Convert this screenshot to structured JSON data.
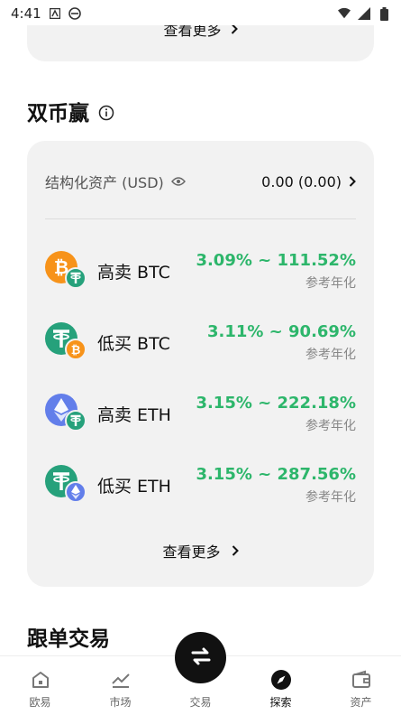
{
  "status_bar": {
    "time": "4:41"
  },
  "top_card": {
    "link_label": "查看更多"
  },
  "dual_currency": {
    "title": "双币赢",
    "assets_label": "结构化资产 (USD)",
    "assets_value": "0.00 (0.00)",
    "products": [
      {
        "name": "高卖 BTC",
        "rate": "3.09% ~ 111.52%",
        "sub": "参考年化"
      },
      {
        "name": "低买 BTC",
        "rate": "3.11% ~ 90.69%",
        "sub": "参考年化"
      },
      {
        "name": "高卖 ETH",
        "rate": "3.15% ~ 222.18%",
        "sub": "参考年化"
      },
      {
        "name": "低买 ETH",
        "rate": "3.15% ~ 287.56%",
        "sub": "参考年化"
      }
    ],
    "more_label": "查看更多"
  },
  "copy_trading": {
    "title": "跟单交易"
  },
  "bottom_nav": {
    "items": [
      {
        "label": "欧易"
      },
      {
        "label": "市场"
      },
      {
        "label": "交易"
      },
      {
        "label": "探索"
      },
      {
        "label": "资产"
      }
    ],
    "active": "探索"
  },
  "colors": {
    "accent_green": "#2db66b",
    "btc": "#f7931a",
    "usdt": "#26a17b",
    "eth": "#627eea"
  }
}
